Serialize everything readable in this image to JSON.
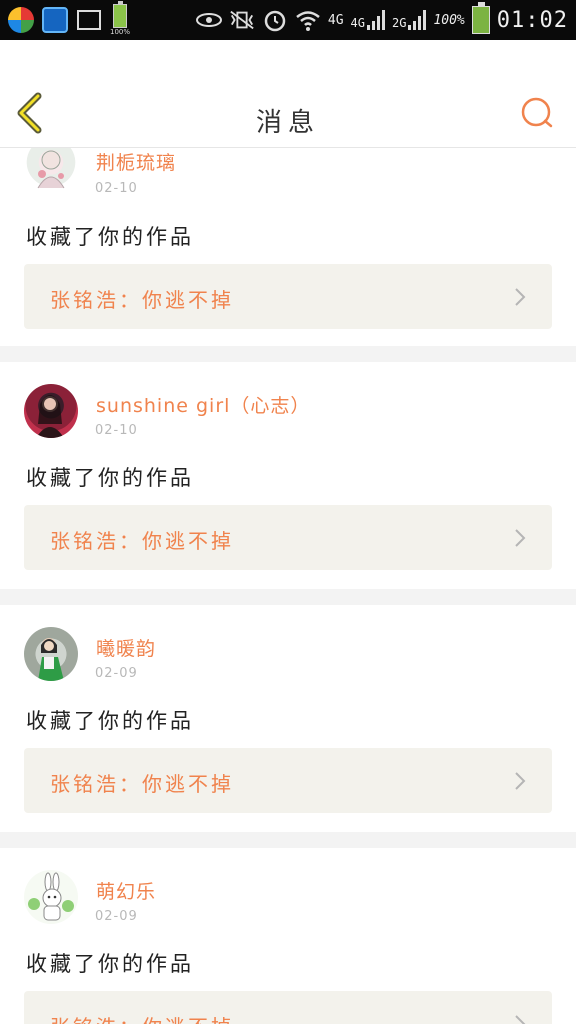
{
  "status_bar": {
    "battery_pct_small": "100%",
    "net_labels": [
      "4G",
      "4G",
      "2G"
    ],
    "battery_pct": "100%",
    "time": "01:02"
  },
  "header": {
    "title": "消息"
  },
  "colors": {
    "accent_orange": "#f0834d",
    "box_bg": "#f3f2ec",
    "separator": "#f3f3f3"
  },
  "notifications": [
    {
      "username": "荆栀琉璃",
      "date": "02-10",
      "action": "收藏了你的作品",
      "work": "张铭浩：你逃不掉",
      "avatar": "avatar-girl-sketch"
    },
    {
      "username": "sunshine girl（心志）",
      "date": "02-10",
      "action": "收藏了你的作品",
      "work": "张铭浩：你逃不掉",
      "avatar": "avatar-girl-dark"
    },
    {
      "username": "曦暖韵",
      "date": "02-09",
      "action": "收藏了你的作品",
      "work": "张铭浩：你逃不掉",
      "avatar": "avatar-girl-green"
    },
    {
      "username": "萌幻乐",
      "date": "02-09",
      "action": "收藏了你的作品",
      "work": "张铭浩：你逃不掉",
      "avatar": "avatar-rabbit"
    }
  ]
}
